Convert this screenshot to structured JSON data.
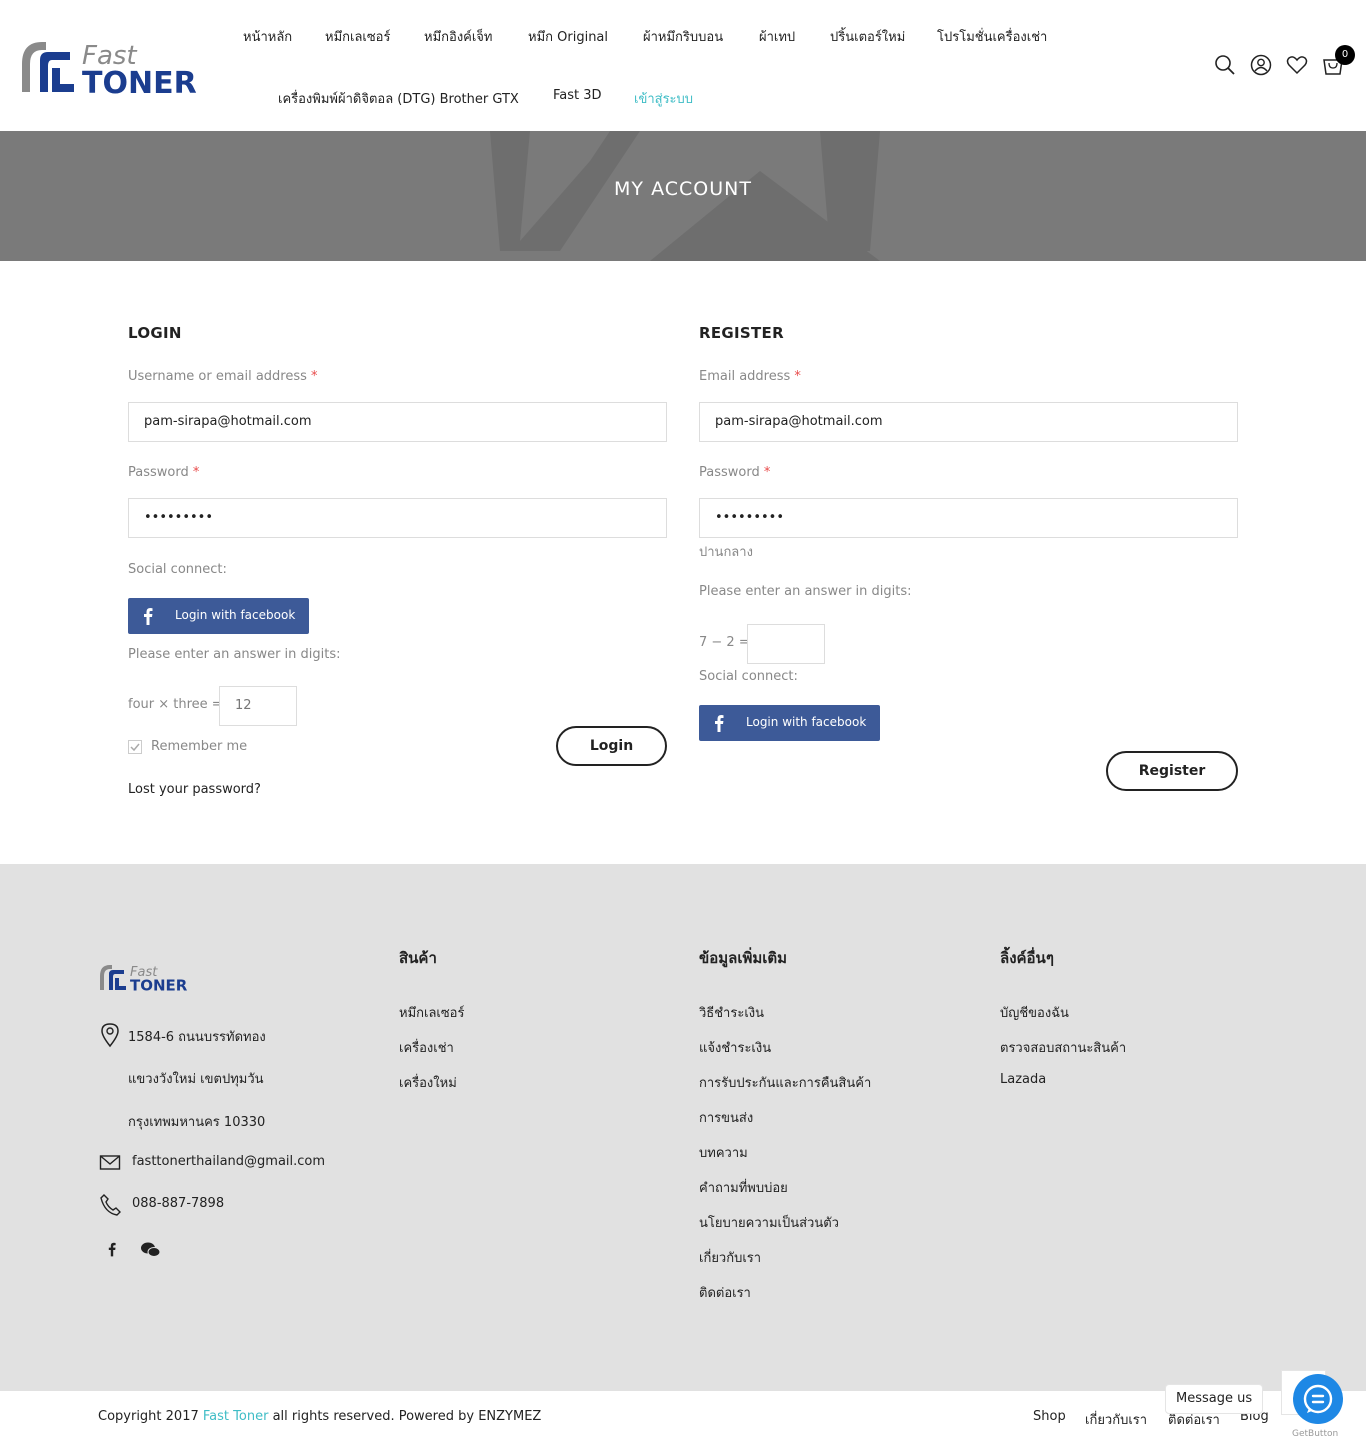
{
  "header": {
    "logo_text_top": "Fast",
    "logo_text_bottom": "TONER",
    "nav": [
      "หน้าหลัก",
      "หมึกเลเซอร์",
      "หมึกอิงค์เจ็ท",
      "หมึก Original",
      "ผ้าหมึกริบบอน",
      "ผ้าเทป",
      "ปริ้นเตอร์ใหม่",
      "โปรโมชั่นเครื่องเช่า",
      "เครื่องพิมพ์ผ้าดิจิตอล (DTG) Brother GTX",
      "Fast 3D",
      "เข้าสู่ระบบ"
    ],
    "cart_count": "0",
    "icons": [
      "search-icon",
      "user-icon",
      "heart-icon",
      "cart-icon"
    ]
  },
  "banner": {
    "title": "MY ACCOUNT"
  },
  "login": {
    "title": "LOGIN",
    "username_label": "Username or email address",
    "username_value": "pam-sirapa@hotmail.com",
    "password_label": "Password",
    "password_value": "•••••••••",
    "social_label": "Social connect:",
    "facebook_label": "Login with facebook",
    "captcha_prompt": "Please enter an answer in digits:",
    "captcha_question": "four × three =",
    "captcha_value": "12",
    "remember_label": "Remember me",
    "submit_label": "Login",
    "lost_password": "Lost your password?"
  },
  "register": {
    "title": "REGISTER",
    "email_label": "Email address",
    "email_value": "pam-sirapa@hotmail.com",
    "password_label": "Password",
    "password_value": "•••••••••",
    "strength_text": "ปานกลาง",
    "captcha_prompt": "Please enter an answer in digits:",
    "captcha_question": "7 − 2 =",
    "captcha_value": "",
    "social_label": "Social connect:",
    "facebook_label": "Login with facebook",
    "submit_label": "Register"
  },
  "required_mark": "*",
  "footer": {
    "address_lines": [
      "1584-6 ถนนบรรทัดทอง",
      "แขวงวังใหม่ เขตปทุมวัน",
      "กรุงเทพมหานคร 10330"
    ],
    "email": "fasttonerthailand@gmail.com",
    "phone": "088-887-7898",
    "col_products": {
      "title": "สินค้า",
      "links": [
        "หมึกเลเซอร์",
        "เครื่องเช่า",
        "เครื่องใหม่"
      ]
    },
    "col_info": {
      "title": "ข้อมูลเพิ่มเติม",
      "links": [
        "วิธีชำระเงิน",
        "แจ้งชำระเงิน",
        "การรับประกันและการคืนสินค้า",
        "การขนส่ง",
        "บทความ",
        "คำถามที่พบบ่อย",
        "นโยบายความเป็นส่วนตัว",
        "เกี่ยวกับเรา",
        "ติดต่อเรา"
      ]
    },
    "col_other": {
      "title": "ลิ้งค์อื่นๆ",
      "links": [
        "บัญชีของฉัน",
        "ตรวจสอบสถานะสินค้า",
        "Lazada"
      ]
    }
  },
  "bottom": {
    "copyright_pre": "Copyright 2017",
    "brand": "Fast Toner",
    "copyright_post": "all rights reserved. Powered by ENZYMEZ",
    "links": [
      "Shop",
      "เกี่ยวกับเรา",
      "ติดต่อเรา",
      "Blog"
    ],
    "message_us": "Message us",
    "getbutton": "GetButton"
  },
  "colors": {
    "accent": "#3fbdc6",
    "facebook": "#3d5a98",
    "banner": "#7a7a7a",
    "footer": "#e1e1e1",
    "chat": "#1e88e5"
  }
}
